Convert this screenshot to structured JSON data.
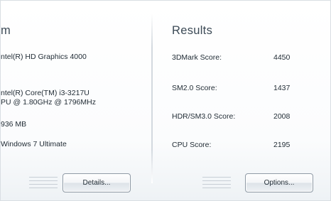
{
  "system": {
    "heading": "m",
    "graphics": "ntel(R) HD Graphics 4000",
    "processor_line1": "ntel(R) Core(TM) i3-3217U",
    "processor_line2": "PU @ 1.80GHz @ 1796MHz",
    "memory": "936 MB",
    "os": "Windows 7 Ultimate",
    "details_button": "Details..."
  },
  "results": {
    "heading": "Results",
    "rows": [
      {
        "label": "3DMark Score:",
        "value": "4450"
      },
      {
        "label": "SM2.0 Score:",
        "value": "1437"
      },
      {
        "label": "HDR/SM3.0 Score:",
        "value": "2008"
      },
      {
        "label": "CPU Score:",
        "value": "2195"
      }
    ],
    "options_button": "Options..."
  }
}
